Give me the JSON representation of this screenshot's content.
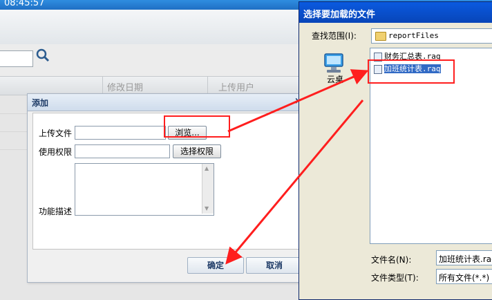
{
  "main": {
    "time": "08:45:57",
    "grid_headers": [
      "修改日期",
      "上传用户"
    ]
  },
  "add_dialog": {
    "title": "添加",
    "close": "×",
    "upload_label": "上传文件",
    "upload_value": "",
    "browse_button": "浏览...",
    "permission_label": "使用权限",
    "permission_value": "",
    "select_permission_button": "选择权限",
    "description_label": "功能描述",
    "description_value": "",
    "ok_button": "确定",
    "cancel_button": "取消"
  },
  "file_dialog": {
    "title": "选择要加载的文件",
    "look_in_label": "查找范围(I):",
    "look_in_value": "reportFiles",
    "places_label": "云桌",
    "files": [
      {
        "name": "财务汇总表.raq",
        "selected": false
      },
      {
        "name": "加班统计表.raq",
        "selected": true
      }
    ],
    "filename_label": "文件名(N):",
    "filename_value": "加班统计表.raq",
    "filetype_label": "文件类型(T):",
    "filetype_value": "所有文件(*.*)"
  },
  "annotation": {
    "color": "#ff1e1e"
  }
}
